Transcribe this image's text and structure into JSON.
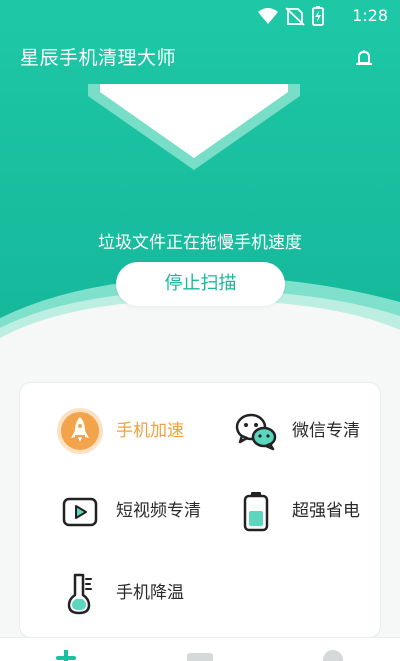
{
  "status_bar": {
    "time": "1:28",
    "icons": [
      "wifi-icon",
      "no-sim-icon",
      "battery-charging-icon"
    ]
  },
  "header": {
    "title": "星辰手机清理大师",
    "notify_icon": "bell-icon"
  },
  "scan": {
    "status_text": "垃圾文件正在拖慢手机速度",
    "stop_label": "停止扫描"
  },
  "features": [
    {
      "label": "手机加速",
      "icon": "rocket-icon",
      "active": true
    },
    {
      "label": "微信专清",
      "icon": "wechat-icon",
      "active": false
    },
    {
      "label": "短视频专清",
      "icon": "video-play-icon",
      "active": false
    },
    {
      "label": "超强省电",
      "icon": "battery-icon",
      "active": false
    },
    {
      "label": "手机降温",
      "icon": "thermometer-icon",
      "active": false
    }
  ],
  "bottom_nav": [
    {
      "icon": "home-plus-icon"
    },
    {
      "icon": "tools-icon"
    },
    {
      "icon": "profile-icon"
    }
  ],
  "colors": {
    "primary": "#19c29f",
    "primary_light": "#5fd8bf",
    "accent_orange": "#f2a23a",
    "text_dark": "#2a2a2a"
  }
}
